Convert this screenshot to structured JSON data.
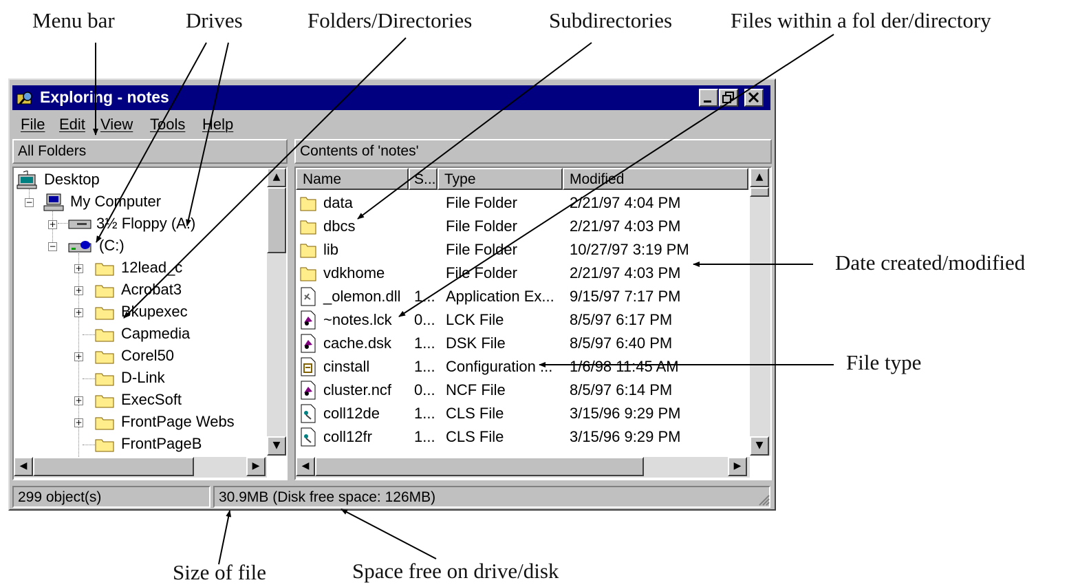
{
  "annotations": {
    "menu_bar": "Menu bar",
    "drives": "Drives",
    "folders": "Folders/Directories",
    "subdirectories": "Subdirectories",
    "files": "Files within a fol der/directory",
    "date": "Date created/modified",
    "file_type": "File type",
    "size": "Size of file",
    "space": "Space free on drive/disk"
  },
  "window": {
    "title": "Exploring - notes",
    "menu": [
      "File",
      "Edit",
      "View",
      "Tools",
      "Help"
    ],
    "left_header": "All Folders",
    "right_header": "Contents of 'notes'"
  },
  "tree": [
    {
      "label": "Desktop",
      "icon": "desktop-icon"
    },
    {
      "label": "My Computer",
      "icon": "computer-icon"
    },
    {
      "label": "3½ Floppy (A:)",
      "icon": "floppy-drive-icon"
    },
    {
      "label": "(C:)",
      "icon": "hard-drive-icon"
    },
    {
      "label": "12lead_c",
      "icon": "folder-icon"
    },
    {
      "label": "Acrobat3",
      "icon": "folder-icon"
    },
    {
      "label": "Bkupexec",
      "icon": "folder-icon"
    },
    {
      "label": "Capmedia",
      "icon": "folder-icon"
    },
    {
      "label": "Corel50",
      "icon": "folder-icon"
    },
    {
      "label": "D-Link",
      "icon": "folder-icon"
    },
    {
      "label": "ExecSoft",
      "icon": "folder-icon"
    },
    {
      "label": "FrontPage Webs",
      "icon": "folder-icon"
    },
    {
      "label": "FrontPageB",
      "icon": "folder-icon"
    }
  ],
  "columns": [
    "Name",
    "S...",
    "Type",
    "Modified"
  ],
  "files": [
    {
      "name": "data",
      "size": "",
      "type": "File Folder",
      "modified": "2/21/97 4:04 PM",
      "icon": "folder-icon"
    },
    {
      "name": "dbcs",
      "size": "",
      "type": "File Folder",
      "modified": "2/21/97 4:03 PM",
      "icon": "folder-icon"
    },
    {
      "name": "lib",
      "size": "",
      "type": "File Folder",
      "modified": "10/27/97 3:19 PM",
      "icon": "folder-icon"
    },
    {
      "name": "vdkhome",
      "size": "",
      "type": "File Folder",
      "modified": "2/21/97 4:03 PM",
      "icon": "folder-icon"
    },
    {
      "name": "_olemon.dll",
      "size": "1...",
      "type": "Application Ex...",
      "modified": "9/15/97 7:17 PM",
      "icon": "dll-icon"
    },
    {
      "name": "~notes.lck",
      "size": "0...",
      "type": "LCK File",
      "modified": "8/5/97 6:17 PM",
      "icon": "notes-file-icon"
    },
    {
      "name": "cache.dsk",
      "size": "1...",
      "type": "DSK File",
      "modified": "8/5/97 6:40 PM",
      "icon": "notes-file-icon"
    },
    {
      "name": "cinstall",
      "size": "1...",
      "type": "Configuration ...",
      "modified": "1/6/98 11:45 AM",
      "icon": "config-file-icon"
    },
    {
      "name": "cluster.ncf",
      "size": "0...",
      "type": "NCF File",
      "modified": "8/5/97 6:14 PM",
      "icon": "notes-file-icon"
    },
    {
      "name": "coll12de",
      "size": "1...",
      "type": "CLS File",
      "modified": "3/15/96 9:29 PM",
      "icon": "cls-file-icon"
    },
    {
      "name": "coll12fr",
      "size": "1...",
      "type": "CLS File",
      "modified": "3/15/96 9:29 PM",
      "icon": "cls-file-icon"
    }
  ],
  "status": {
    "objects": "299 object(s)",
    "size": "30.9MB (Disk free space: 126MB)"
  },
  "colors": {
    "titlebar": "#000080",
    "window": "#c0c0c0"
  }
}
